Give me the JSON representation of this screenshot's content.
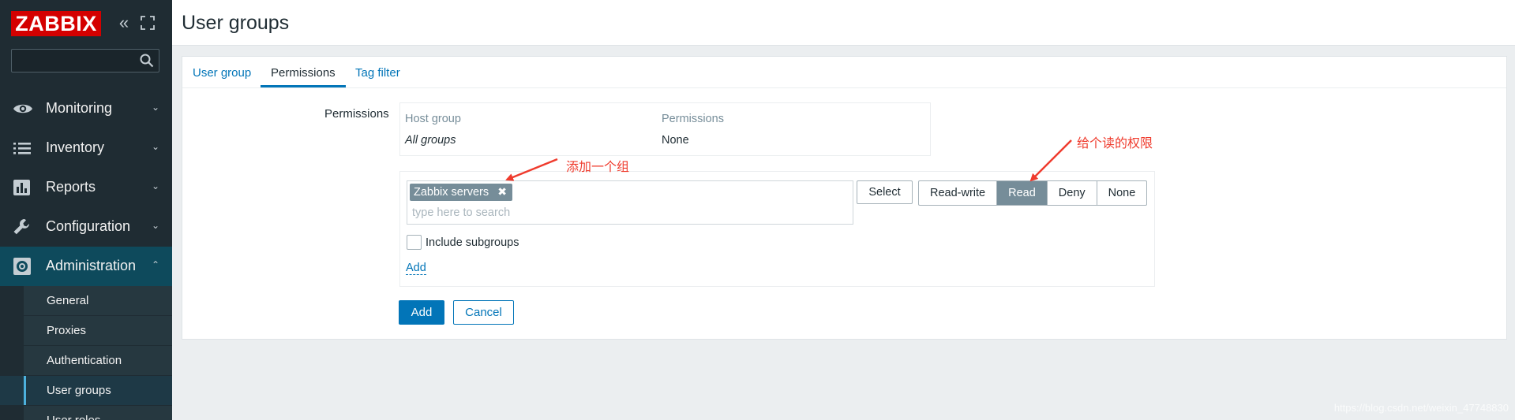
{
  "sidebar": {
    "logo": "ZABBIX",
    "collapse_icon": "«",
    "search": {
      "value": "",
      "placeholder": ""
    },
    "menu": [
      {
        "label": "Monitoring",
        "icon": "eye-icon",
        "chevron": "⌄"
      },
      {
        "label": "Inventory",
        "icon": "list-icon",
        "chevron": "⌄"
      },
      {
        "label": "Reports",
        "icon": "bar-chart-icon",
        "chevron": "⌄"
      },
      {
        "label": "Configuration",
        "icon": "wrench-icon",
        "chevron": "⌄"
      },
      {
        "label": "Administration",
        "icon": "gear-icon",
        "chevron": "⌃"
      }
    ],
    "submenu": [
      "General",
      "Proxies",
      "Authentication",
      "User groups",
      "User roles"
    ]
  },
  "header": {
    "title": "User groups"
  },
  "tabs": [
    "User group",
    "Permissions",
    "Tag filter"
  ],
  "permissions": {
    "label": "Permissions",
    "table": {
      "headers": [
        "Host group",
        "Permissions"
      ],
      "rows": [
        [
          "All groups",
          "None"
        ]
      ]
    },
    "selected_group": "Zabbix servers",
    "chip_remove_icon": "✖",
    "search_placeholder": "type here to search",
    "select_button": "Select",
    "levels": [
      "Read-write",
      "Read",
      "Deny",
      "None"
    ],
    "active_level": "Read",
    "include_subgroups": "Include subgroups",
    "add_link": "Add"
  },
  "actions": {
    "add": "Add",
    "cancel": "Cancel"
  },
  "annotations": {
    "add_group": "添加一个组",
    "read_permission": "给个读的权限"
  },
  "watermark": "https://blog.csdn.net/weixin_47748830",
  "colors": {
    "sidebar": "#1f2c33",
    "accent": "#0275b8",
    "logo": "#d40000",
    "annotation": "#ef3b2d",
    "active_radio": "#768d99"
  }
}
